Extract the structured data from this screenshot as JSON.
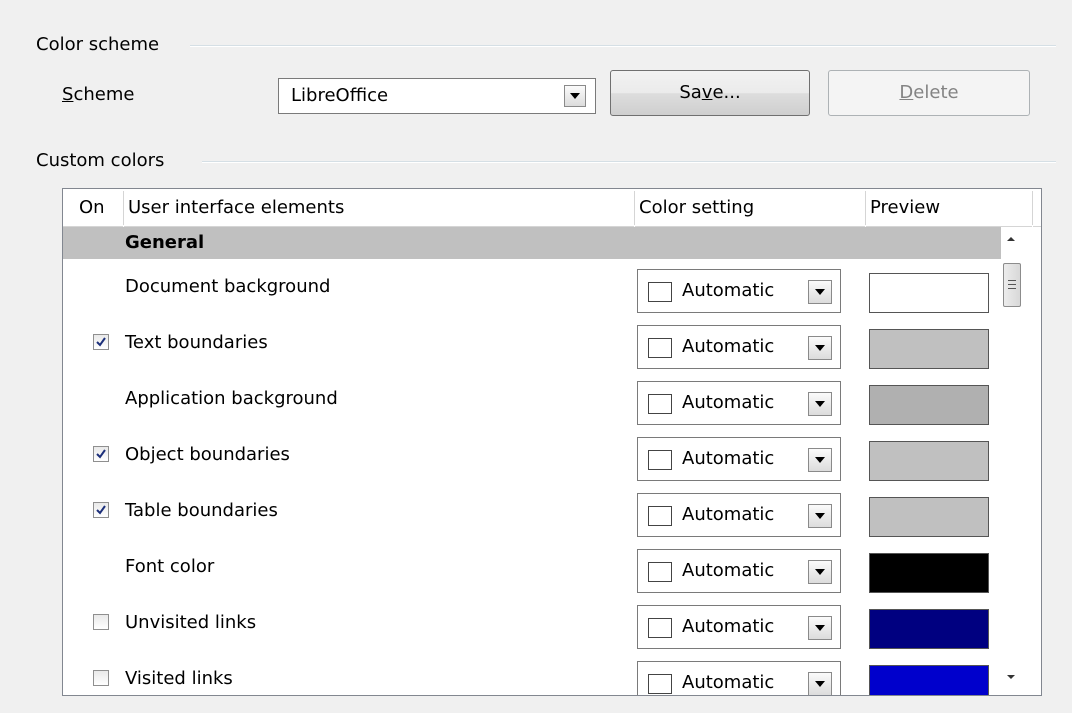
{
  "color_scheme": {
    "group_label": "Color scheme",
    "scheme_label_mnemonic": "S",
    "scheme_label_rest": "cheme",
    "scheme_value": "LibreOffice",
    "save_pre": "Sa",
    "save_mnemonic": "v",
    "save_post": "e...",
    "delete_mnemonic": "D",
    "delete_rest": "elete"
  },
  "custom_colors": {
    "group_label": "Custom colors",
    "columns": {
      "on": "On",
      "element": "User interface elements",
      "setting": "Color setting",
      "preview": "Preview"
    },
    "category": "General",
    "rows": [
      {
        "label": "Document background",
        "has_checkbox": false,
        "checked": false,
        "setting": "Automatic",
        "preview_color": "#ffffff"
      },
      {
        "label": "Text boundaries",
        "has_checkbox": true,
        "checked": true,
        "setting": "Automatic",
        "preview_color": "#c0c0c0"
      },
      {
        "label": "Application background",
        "has_checkbox": false,
        "checked": false,
        "setting": "Automatic",
        "preview_color": "#b0b0b0"
      },
      {
        "label": "Object boundaries",
        "has_checkbox": true,
        "checked": true,
        "setting": "Automatic",
        "preview_color": "#c0c0c0"
      },
      {
        "label": "Table boundaries",
        "has_checkbox": true,
        "checked": true,
        "setting": "Automatic",
        "preview_color": "#c0c0c0"
      },
      {
        "label": "Font color",
        "has_checkbox": false,
        "checked": false,
        "setting": "Automatic",
        "preview_color": "#000000"
      },
      {
        "label": "Unvisited links",
        "has_checkbox": true,
        "checked": false,
        "setting": "Automatic",
        "preview_color": "#000080"
      },
      {
        "label": "Visited links",
        "has_checkbox": true,
        "checked": false,
        "setting": "Automatic",
        "preview_color": "#0000cc"
      }
    ]
  }
}
